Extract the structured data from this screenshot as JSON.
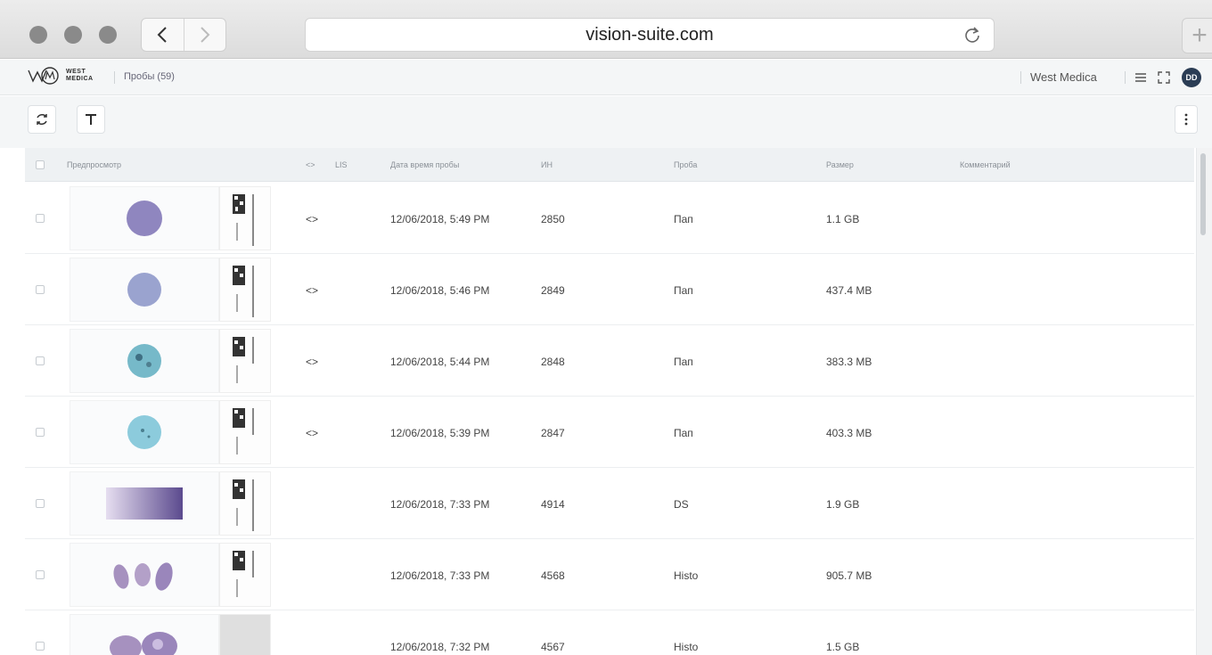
{
  "browser": {
    "url": "vision-suite.com",
    "traffic_colors": [
      "#8a8a8a",
      "#8a8a8a",
      "#8a8a8a"
    ]
  },
  "header": {
    "logo_text_line1": "WEST",
    "logo_text_line2": "MEDICA",
    "breadcrumb": "Пробы (59)",
    "organization": "West Medica",
    "avatar_initials": "DD"
  },
  "table": {
    "columns": {
      "preview": "Предпросмотр",
      "view": "<>",
      "lis": "LIS",
      "datetime": "Дата время пробы",
      "id": "ИН",
      "sample": "Проба",
      "size": "Размер",
      "comment": "Комментарий"
    },
    "rows": [
      {
        "view": "<>",
        "datetime": "12/06/2018, 5:49 PM",
        "id": "2850",
        "sample": "Пап",
        "size": "1.1 GB",
        "thumb": "circle",
        "color": "#8f86bf"
      },
      {
        "view": "<>",
        "datetime": "12/06/2018, 5:46 PM",
        "id": "2849",
        "sample": "Пап",
        "size": "437.4 MB",
        "thumb": "circle",
        "color": "#9aa3cf"
      },
      {
        "view": "<>",
        "datetime": "12/06/2018, 5:44 PM",
        "id": "2848",
        "sample": "Пап",
        "size": "383.3 MB",
        "thumb": "circle",
        "color": "#76b9c9"
      },
      {
        "view": "<>",
        "datetime": "12/06/2018, 5:39 PM",
        "id": "2847",
        "sample": "Пап",
        "size": "403.3 MB",
        "thumb": "circle",
        "color": "#8ccbdc"
      },
      {
        "view": "",
        "datetime": "12/06/2018, 7:33 PM",
        "id": "4914",
        "sample": "DS",
        "size": "1.9 GB",
        "thumb": "rect",
        "color": "#7c6aa6"
      },
      {
        "view": "",
        "datetime": "12/06/2018, 7:33 PM",
        "id": "4568",
        "sample": "Histo",
        "size": "905.7 MB",
        "thumb": "tissue",
        "color": "#a691bf"
      },
      {
        "view": "",
        "datetime": "12/06/2018, 7:32 PM",
        "id": "4567",
        "sample": "Histo",
        "size": "1.5 GB",
        "thumb": "tissue2",
        "color": "#9a86bb"
      }
    ]
  }
}
